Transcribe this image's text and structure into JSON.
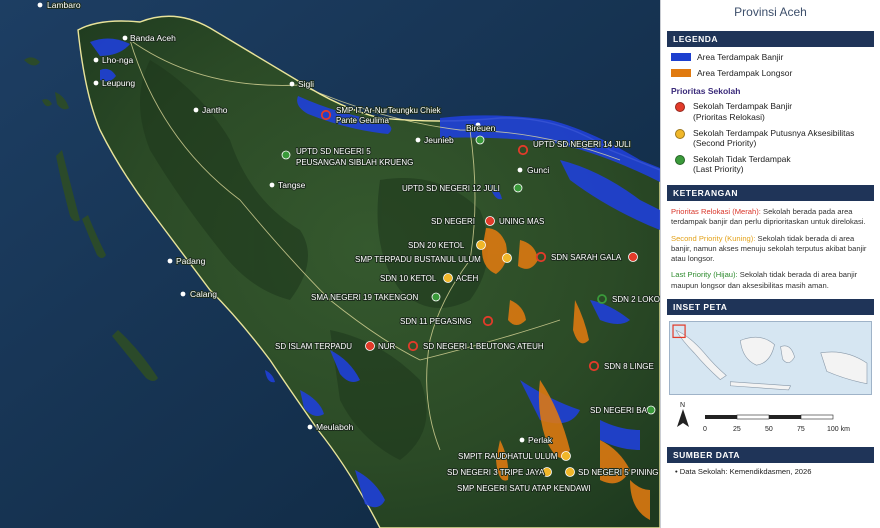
{
  "panel": {
    "title": "Provinsi Aceh",
    "legend_header": "LEGENDA",
    "legend_areas": [
      {
        "label": "Area Terdampak Banjir",
        "color": "#1d3fcf"
      },
      {
        "label": "Area Terdampak Longsor",
        "color": "#e07a10"
      }
    ],
    "priority_header": "Prioritas Sekolah",
    "priority_items": [
      {
        "line1": "Sekolah Terdampak Banjir",
        "line2": "(Prioritas Relokasi)",
        "color": "#e23b2a"
      },
      {
        "line1": "Sekolah Terdampak Putusnya Aksesibilitas",
        "line2": "(Second Priority)",
        "color": "#f0b72a"
      },
      {
        "line1": "Sekolah Tidak Terdampak",
        "line2": "(Last Priority)",
        "color": "#3a9a3a"
      }
    ],
    "keterangan_header": "KETERANGAN",
    "keterangan": [
      {
        "term": "Prioritas Relokasi (Merah):",
        "text": "Sekolah berada pada area terdampak banjir dan perlu diprioritaskan untuk direlokasi.",
        "color": "#d9362a"
      },
      {
        "term": "Second Priority (Kuning):",
        "text": "Sekolah tidak berada di area banjir, namun akses menuju sekolah terputus akibat banjir atau longsor.",
        "color": "#e3a21a"
      },
      {
        "term": "Last Priority (Hijau):",
        "text": "Sekolah tidak berada di area banjir maupun longsor dan aksesibilitas masih aman.",
        "color": "#2e8b2e"
      }
    ],
    "inset_header": "INSET PETA",
    "north_label": "N",
    "scale_ticks": [
      "0",
      "25",
      "50",
      "75",
      "100 km"
    ],
    "source_header": "SUMBER DATA",
    "source_line": "• Data Sekolah: Kemendikdasmen, 2026"
  },
  "towns": [
    {
      "name": "Lambaro"
    },
    {
      "name": "Banda Aceh"
    },
    {
      "name": "Lho-nga"
    },
    {
      "name": "Leupung"
    },
    {
      "name": "Jantho"
    },
    {
      "name": "Sigli"
    },
    {
      "name": "Jeunieb"
    },
    {
      "name": "Bireuen"
    },
    {
      "name": "Gunci"
    },
    {
      "name": "Tangse"
    },
    {
      "name": "Padang"
    },
    {
      "name": "Calang"
    },
    {
      "name": "Meulaboh"
    },
    {
      "name": "Perlak"
    }
  ],
  "schools": [
    {
      "name": "SMP IT Ar-NurTeungku Chiek",
      "name2": "Pante Geulima",
      "priority": "red"
    },
    {
      "name": "UPTD SD NEGERI 5",
      "name2": "PEUSANGAN SIBLAH KRUENG",
      "priority": "green"
    },
    {
      "name": "UPTD SD NEGERI 14 JULI",
      "priority": "red"
    },
    {
      "name": "UPTD SD NEGERI 12 JULI",
      "priority": "green"
    },
    {
      "name": "SD NEGERI",
      "priority": "red"
    },
    {
      "name": "UNING MAS",
      "priority": "label"
    },
    {
      "name": "SDN 20 KETOL",
      "priority": "yellow"
    },
    {
      "name": "SMP TERPADU BUSTANUL ULUM",
      "priority": "yellow"
    },
    {
      "name": "SDN SARAH GALA",
      "priority": "red"
    },
    {
      "name": "SDN 10 KETOL",
      "priority": "yellow"
    },
    {
      "name": "ACEH",
      "priority": "label"
    },
    {
      "name": "SMA NEGERI 19 TAKENGON",
      "priority": "green"
    },
    {
      "name": "SDN 2 LOKOP",
      "priority": "green"
    },
    {
      "name": "SDN 11 PEGASING",
      "priority": "red"
    },
    {
      "name": "SD ISLAM TERPADU",
      "priority": "red"
    },
    {
      "name": "NUR",
      "priority": "label"
    },
    {
      "name": "SD NEGERI 1 BEUTONG ATEUH",
      "priority": "red"
    },
    {
      "name": "SDN 8 LINGE",
      "priority": "red"
    },
    {
      "name": "SD NEGERI BA",
      "priority": "green"
    },
    {
      "name": "SMPIT RAUDHATUL ULUM",
      "priority": "yellow"
    },
    {
      "name": "SD NEGERI 3 TRIPE JAYA",
      "priority": "yellow"
    },
    {
      "name": "SD NEGERI 5 PINING",
      "priority": "yellow"
    },
    {
      "name": "SMP NEGERI SATU ATAP KENDAWI",
      "priority": "label"
    }
  ]
}
